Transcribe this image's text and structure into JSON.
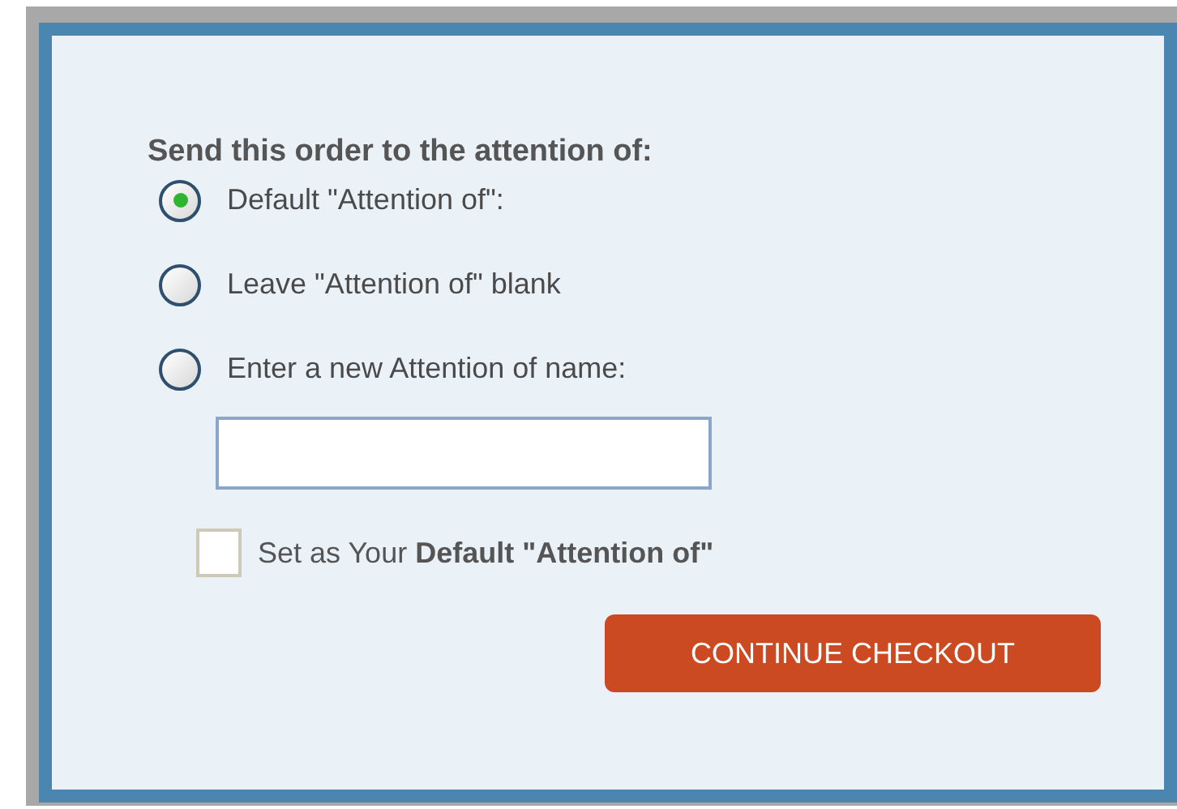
{
  "heading": "Send this order to the attention of:",
  "options": [
    {
      "label": "Default \"Attention of\":",
      "selected": true
    },
    {
      "label": "Leave \"Attention of\" blank",
      "selected": false
    },
    {
      "label": "Enter a new Attention of name:",
      "selected": false
    }
  ],
  "default_checkbox": {
    "label": "Set as Your **Default \"Attention of\"**",
    "checked": false
  },
  "button": "CONTINUE CHECKOUT"
}
